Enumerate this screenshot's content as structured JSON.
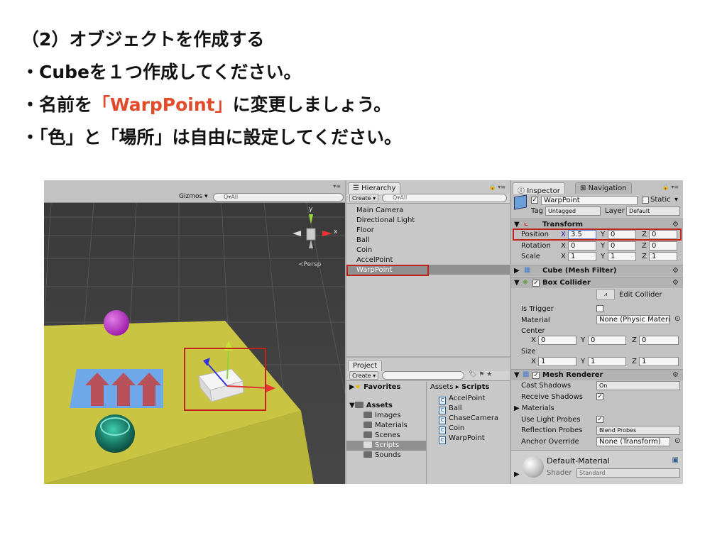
{
  "slide": {
    "line1": "（2）オブジェクトを作成する",
    "line2": "・Cubeを１つ作成してください。",
    "line3_pre": "・名前を",
    "line3_accent": "「WarpPoint」",
    "line3_post": "に変更しましょう。",
    "line4": "・「色」と「場所」は自由に設定してください。"
  },
  "scene": {
    "gizmos": "Gizmos ▾",
    "search_placeholder": "Q▾All",
    "axis_y": "y",
    "axis_x": "x",
    "persp": "≺Persp"
  },
  "hierarchy": {
    "tab": "☰ Hierarchy",
    "create": "Create ▾",
    "search_placeholder": "Q▾All",
    "items": [
      "Main Camera",
      "Directional Light",
      "Floor",
      "Ball",
      "Coin",
      "AccelPoint",
      "WarpPoint"
    ]
  },
  "project": {
    "tab": "Project",
    "create": "Create ▾",
    "favorites": "Favorites",
    "assets": "Assets",
    "folders": [
      "Images",
      "Materials",
      "Scenes",
      "Scripts",
      "Sounds"
    ],
    "breadcrumb_root": "Assets ▸",
    "breadcrumb_current": "Scripts",
    "scripts": [
      "AccelPoint",
      "Ball",
      "ChaseCamera",
      "Coin",
      "WarpPoint"
    ]
  },
  "inspector": {
    "tab": "Inspector",
    "tab2": "Navigation",
    "object_name": "WarpPoint",
    "static": "Static",
    "tag_label": "Tag",
    "tag_value": "Untagged",
    "layer_label": "Layer",
    "layer_value": "Default",
    "transform": {
      "title": "Transform",
      "position_label": "Position",
      "rotation_label": "Rotation",
      "scale_label": "Scale",
      "position": [
        "3.5",
        "0",
        "0"
      ],
      "rotation": [
        "0",
        "0",
        "0"
      ],
      "scale": [
        "1",
        "1",
        "1"
      ]
    },
    "mesh_filter": "Cube (Mesh Filter)",
    "box_collider": {
      "title": "Box Collider",
      "edit": "Edit Collider",
      "is_trigger": "Is Trigger",
      "material_label": "Material",
      "material_value": "None (Physic Material",
      "center_label": "Center",
      "center": [
        "0",
        "0",
        "0"
      ],
      "size_label": "Size",
      "size": [
        "1",
        "1",
        "1"
      ]
    },
    "mesh_renderer": {
      "title": "Mesh Renderer",
      "cast_shadows": "Cast Shadows",
      "cast_shadows_value": "On",
      "receive_shadows": "Receive Shadows",
      "materials": "Materials",
      "light_probes": "Use Light Probes",
      "reflection_probes": "Reflection Probes",
      "reflection_value": "Blend Probes",
      "anchor_override": "Anchor Override",
      "anchor_value": "None (Transform)"
    },
    "material": {
      "name": "Default-Material",
      "shader_label": "Shader",
      "shader_value": "Standard"
    }
  },
  "axis_labels": {
    "x": "X",
    "y": "Y",
    "z": "Z"
  },
  "colors": {
    "accent": "#e34a2a",
    "highlight_box": "#c0241c",
    "floor": "#c9c441",
    "ball": "#b026c4"
  }
}
